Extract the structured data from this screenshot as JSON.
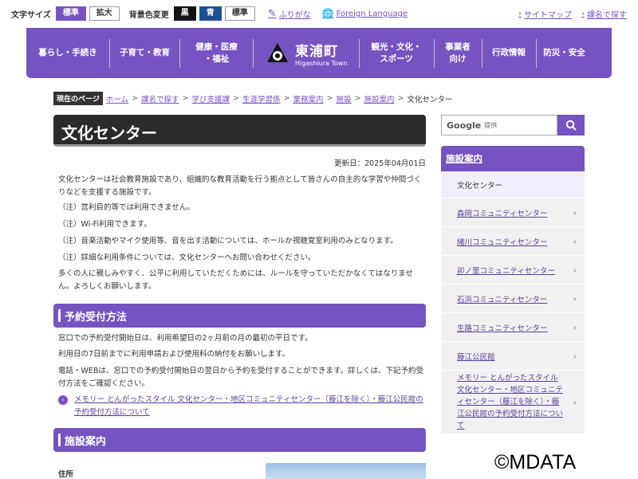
{
  "topbar": {
    "font_size_label": "文字サイズ",
    "font_standard": "標準",
    "font_large": "拡大",
    "bg_color_label": "背景色変更",
    "bg_black": "黒",
    "bg_blue": "青",
    "bg_standard": "標準",
    "furigana": "ふりがな",
    "foreign_language": "Foreign Language",
    "sitemap": "サイトマップ",
    "search_by_section": "課名で探す"
  },
  "nav": {
    "items_left": [
      "暮らし・手続き",
      "子育て・教育",
      "健康・医療\n・福祉"
    ],
    "logo_jp": "東浦町",
    "logo_en": "Higashiura Town",
    "items_right": [
      "観光・文化・\nスポーツ",
      "事業者\n向け",
      "行政情報",
      "防災・安全"
    ]
  },
  "breadcrumb": {
    "label": "現在のページ",
    "links": [
      "ホーム",
      "課名で探す",
      "学び支援課",
      "生涯学習係",
      "業務案内",
      "施設",
      "施設案内"
    ],
    "current": "文化センター"
  },
  "page": {
    "title": "文化センター",
    "updated": "更新日：2025年04月01日",
    "intro": "文化センターは社会教育施設であり、組織的な教育活動を行う拠点として皆さんの自主的な学習や仲間づくりなどを支援する施設です。",
    "notes": [
      "（注）営利目的等では利用できません。",
      "（注）Wi-Fi利用できます。",
      "（注）音楽活動やマイク使用等、音を出す活動については、ホールか視聴覚室利用のみとなります。",
      "（注）詳細な利用条件については、文化センターへお問い合わせください。"
    ],
    "closing": "多くの人に親しみやすく、公平に利用していただくためには、ルールを守っていただかなくてはなりません。よろしくお願いします。",
    "section1_title": "予約受付方法",
    "section1_lines": [
      "窓口での予約受付開始日は、利用希望日の2ヶ月前の月の最初の平日です。",
      "利用日の7日前までに利用申請および使用料の納付をお願いします。",
      "電話・WEBは、窓口での予約受付開始日の翌日から予約を受付することができます。詳しくは、下記予約受付方法をご確認ください。"
    ],
    "section1_link": "メモリー とんがったスタイル 文化センター・地区コミュニティセンター（藤江を除く）・藤江公民館の予約受付方法について",
    "section2_title": "施設案内",
    "address_label": "住所"
  },
  "sidebar": {
    "search_placeholder": "提供",
    "search_brand": "Google",
    "heading": "施設案内",
    "items": [
      "文化センター",
      "森岡コミュニティセンター",
      "緒川コミュニティセンター",
      "卯ノ里コミュニティセンター",
      "石浜コミュニティセンター",
      "生路コミュニティセンター",
      "藤江公民館",
      "メモリー とんがったスタイル 文化センター・地区コミュニティセンター（藤江を除く）・藤江公民館の予約受付方法について"
    ]
  },
  "watermark": "©MDATA",
  "colors": {
    "accent": "#7553c1",
    "title_bg": "#2b2b2b"
  }
}
